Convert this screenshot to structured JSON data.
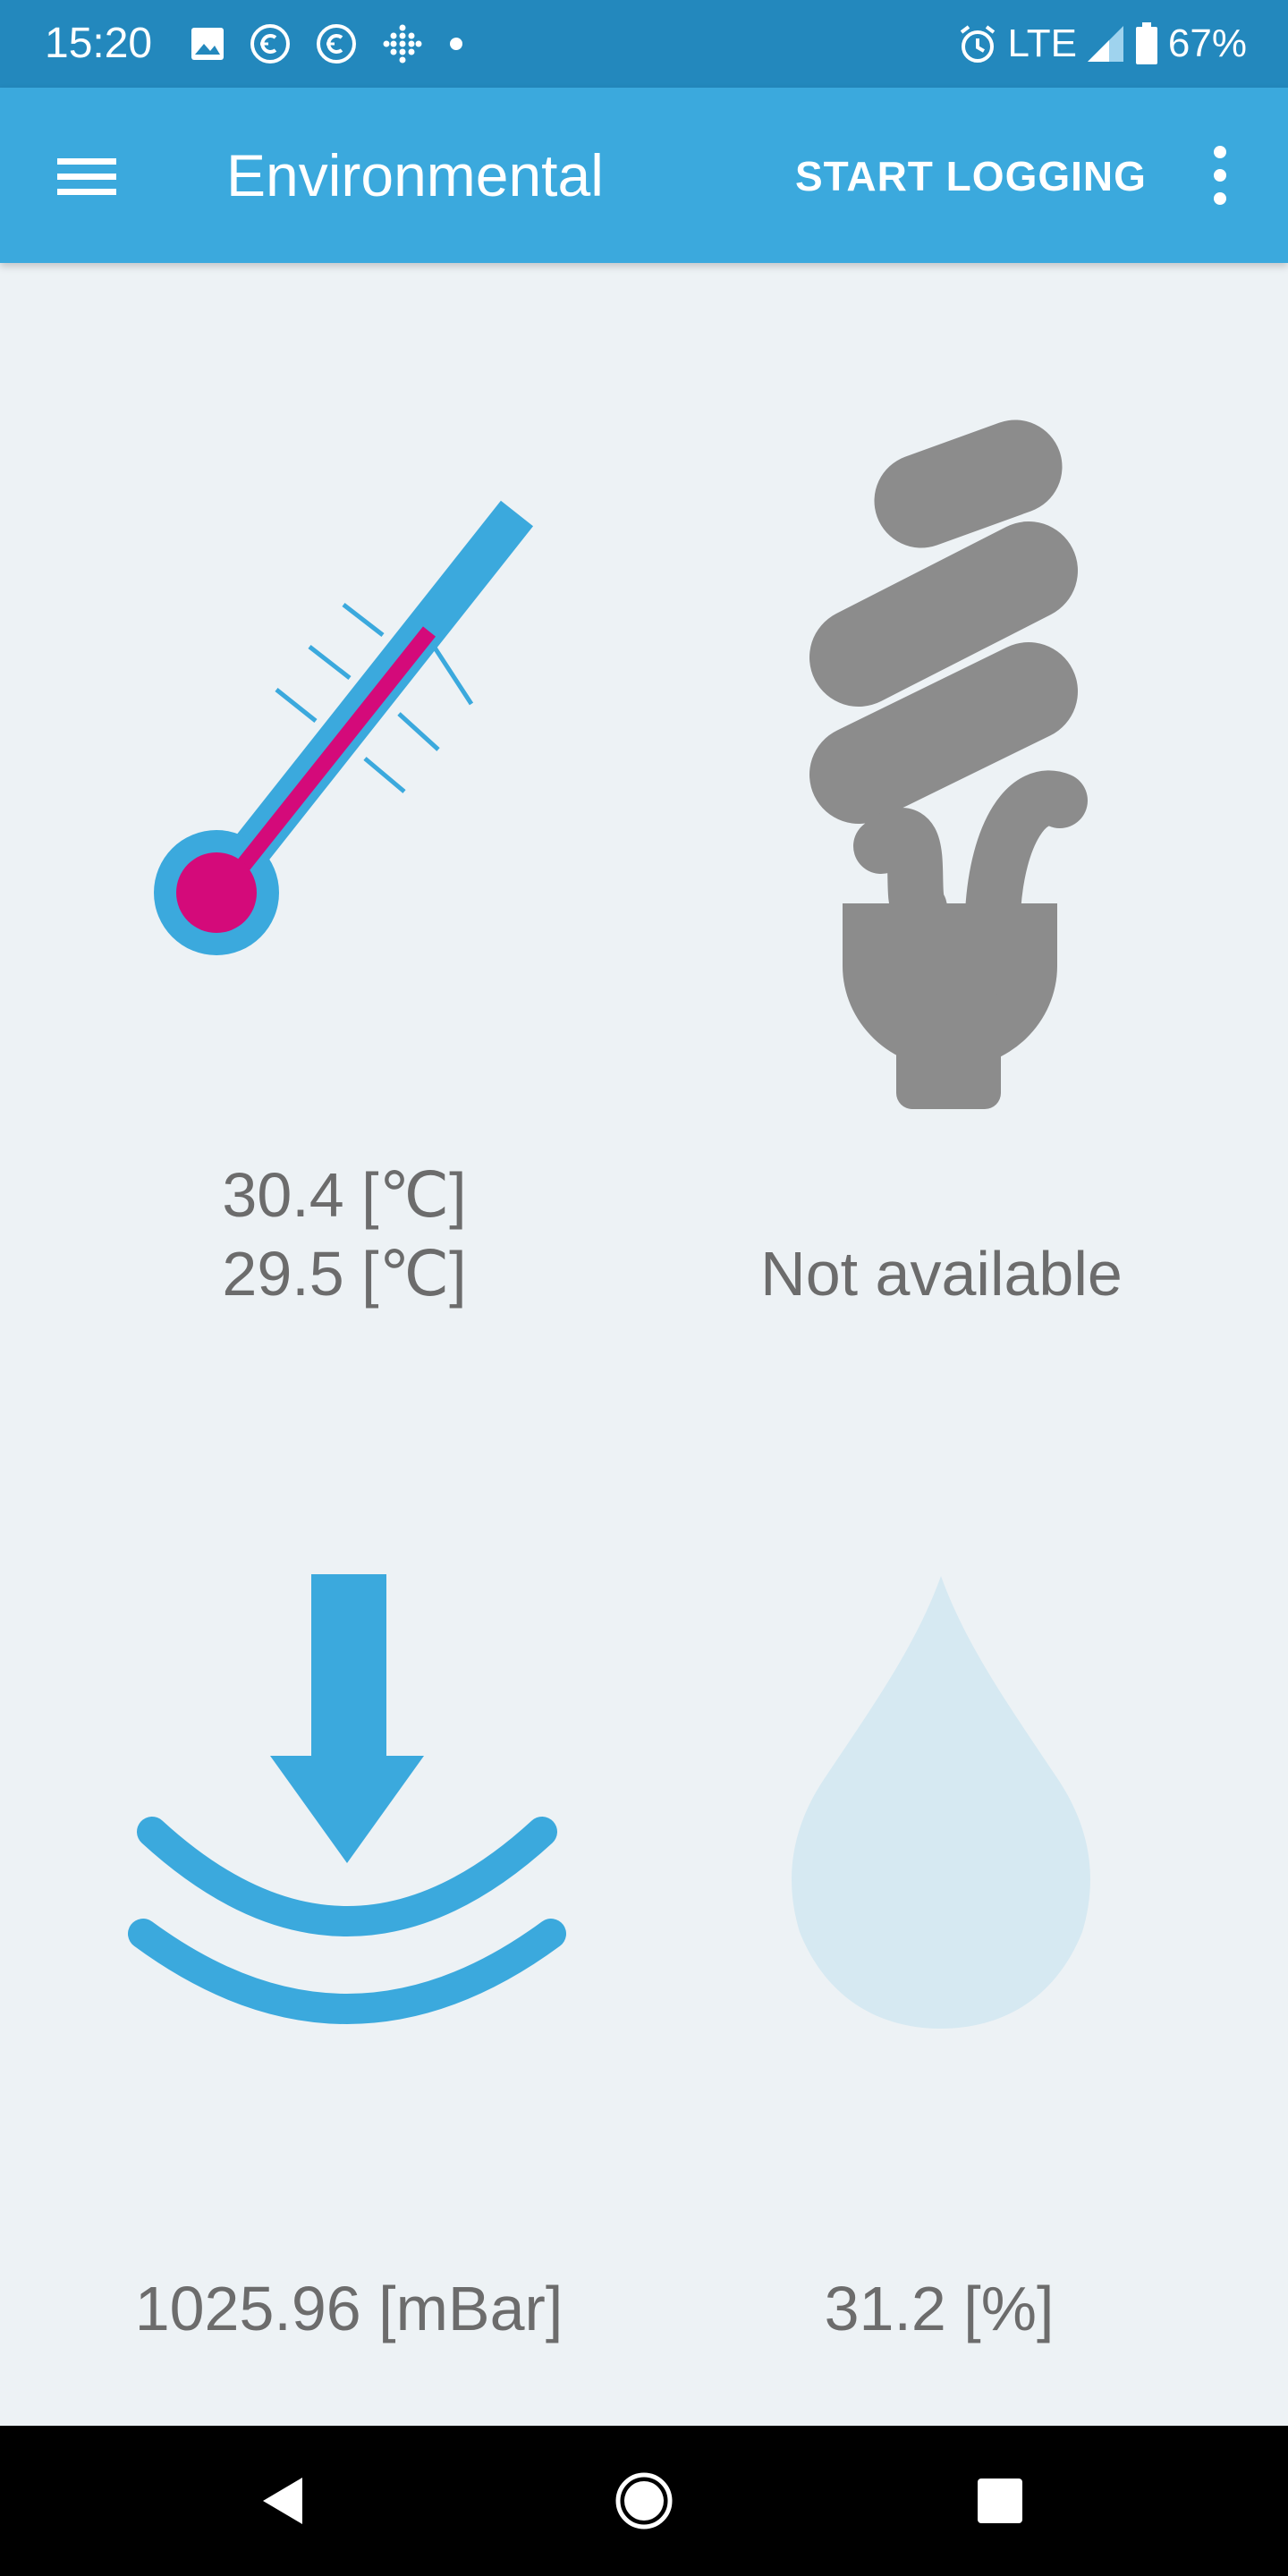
{
  "status_bar": {
    "time": "15:20",
    "icons_left": [
      "image-icon",
      "copyright-icon",
      "copyright-icon",
      "dots-grid-icon",
      "dot-icon"
    ],
    "network": "LTE",
    "battery": "67%",
    "icons_right": [
      "alarm-icon",
      "signal-icon",
      "battery-icon"
    ]
  },
  "app_bar": {
    "title": "Environmental",
    "action": "START LOGGING",
    "menu_icon": "hamburger-menu-icon",
    "overflow_icon": "more-vert-icon"
  },
  "tiles": {
    "temperature": {
      "icon": "thermometer-icon",
      "line1": "30.4 [℃]",
      "line2": "29.5 [℃]"
    },
    "light": {
      "icon": "lightbulb-icon",
      "value": "Not available"
    },
    "pressure": {
      "icon": "pressure-icon",
      "value": "1025.96 [mBar]"
    },
    "humidity": {
      "icon": "water-drop-icon",
      "value": "31.2 [%]"
    }
  },
  "nav_bar": {
    "back": "back-icon",
    "home": "home-icon",
    "recents": "recents-icon"
  },
  "colors": {
    "status_bar": "#2388bd",
    "app_bar": "#3ba9dd",
    "background": "#edf2f5",
    "accent_blue": "#3ba9dd",
    "thermo_red": "#d40a7a",
    "bulb_gray": "#8c8c8c",
    "drop_light": "#d6e9f2",
    "text_gray": "#6c6c6c"
  }
}
